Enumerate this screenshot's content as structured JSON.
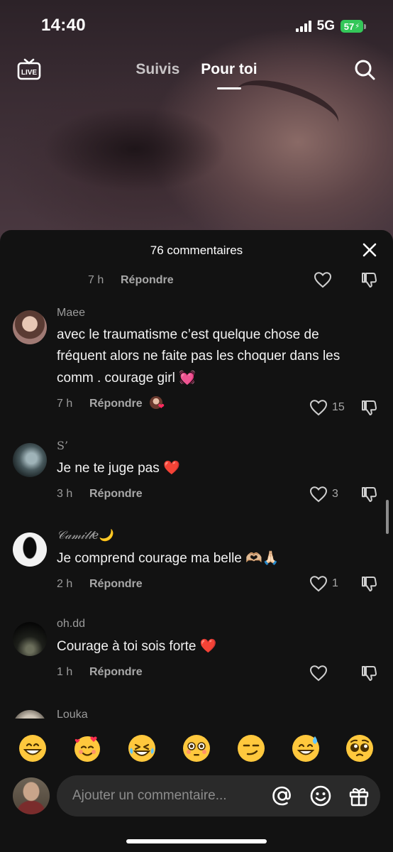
{
  "status_bar": {
    "time": "14:40",
    "network": "5G",
    "battery": "57"
  },
  "top_nav": {
    "tabs": [
      {
        "label": "Suivis"
      },
      {
        "label": "Pour toi"
      }
    ],
    "live_label": "LIVE"
  },
  "comments_sheet": {
    "title": "76 commentaires",
    "partial_comment": {
      "time": "7 h",
      "reply_label": "Répondre"
    },
    "comments": [
      {
        "user": "Maee",
        "text": "avec le traumatisme c’est quelque chose de fréquent alors ne faite pas les choquer dans les comm . courage girl ",
        "emoji": "💓",
        "time": "7 h",
        "reply_label": "Répondre",
        "likes": "15"
      },
      {
        "user": "S’",
        "text": "Je ne te juge pas ",
        "emoji": "❤️",
        "time": "3 h",
        "reply_label": "Répondre",
        "likes": "3"
      },
      {
        "user": "𝒞𝒶𝓂𝒾𝓁𝓁𝑒",
        "user_emoji": "🌙",
        "text": "Je comprend courage ma belle ",
        "emoji": "🫶🏼🙏🏻",
        "time": "2 h",
        "reply_label": "Répondre",
        "likes": "1"
      },
      {
        "user": "oh.dd",
        "text": "Courage à toi sois forte ",
        "emoji": "❤️",
        "time": "1 h",
        "reply_label": "Répondre",
        "likes": ""
      },
      {
        "user": "Louka"
      }
    ]
  },
  "emoji_bar": [
    "😁",
    "🥰",
    "😂",
    "😳",
    "😏",
    "😅",
    "🥺"
  ],
  "composer": {
    "placeholder": "Ajouter un commentaire..."
  },
  "colors": {
    "sheet_bg": "#121212",
    "input_bg": "#2a2a2a",
    "battery_green": "#34c759",
    "heart_red": "#ff2a3d"
  },
  "icons": [
    "live-icon",
    "search-icon",
    "close-icon",
    "heart-icon",
    "dislike-icon",
    "at-icon",
    "smiley-icon",
    "gift-icon"
  ]
}
